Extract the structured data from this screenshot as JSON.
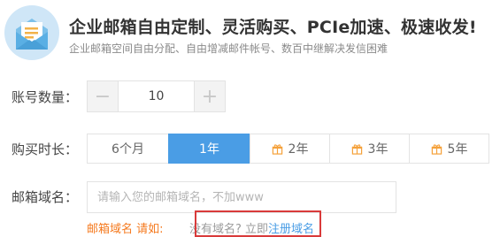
{
  "header": {
    "title": "企业邮箱自由定制、灵活购买、PCIe加速、极速收发!",
    "subtitle": "企业邮箱空间自由分配、自由增减邮件帐号、数百中继解决发信困难",
    "logo_icon": "mail-envelope-icon"
  },
  "account_count": {
    "label": "账号数量：",
    "value": "10",
    "minus": "−",
    "plus": "+"
  },
  "duration": {
    "label": "购买时长：",
    "options": [
      {
        "label": "6个月",
        "selected": false,
        "gift": false
      },
      {
        "label": "1年",
        "selected": true,
        "gift": false
      },
      {
        "label": "2年",
        "selected": false,
        "gift": true
      },
      {
        "label": "3年",
        "selected": false,
        "gift": true
      },
      {
        "label": "5年",
        "selected": false,
        "gift": true
      }
    ]
  },
  "domain": {
    "label": "邮箱域名：",
    "placeholder": "请输入您的邮箱域名，不加www",
    "hint_orange": "邮箱域名 请如:",
    "hint_gray": "没有域名? 立即",
    "hint_link": "注册域名"
  },
  "colors": {
    "accent": "#4a9de5",
    "orange": "#f57a1f",
    "highlight": "#d93a3a"
  }
}
